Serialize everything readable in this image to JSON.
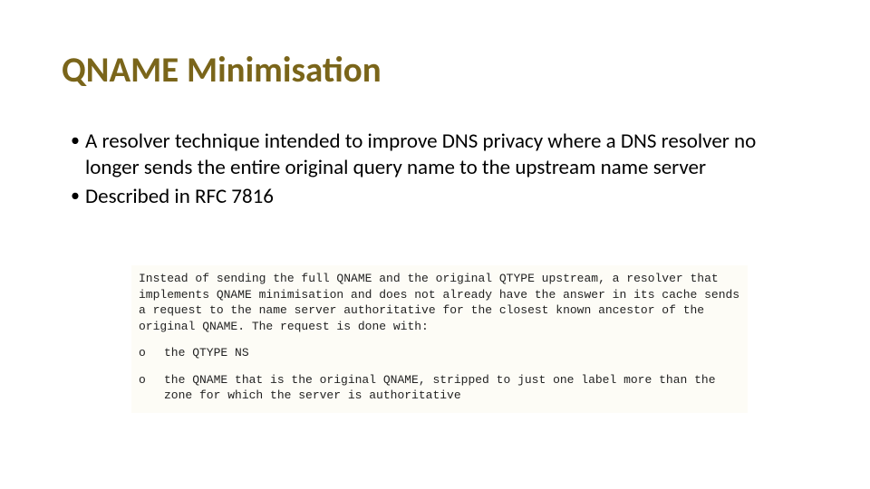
{
  "title": "QNAME Minimisation",
  "bullets": {
    "items": [
      {
        "marker": "•",
        "text": "A resolver technique intended to improve DNS privacy where a DNS resolver no longer sends the entire original query name to the upstream name server"
      },
      {
        "marker": "•",
        "text": "Described in RFC 7816"
      }
    ]
  },
  "excerpt": {
    "intro": "Instead of sending the full QNAME and the original QTYPE upstream, a resolver that implements QNAME minimisation and does not already have the answer in its cache sends a request to the name server authoritative for the closest known ancestor of the original QNAME. The request is done with:",
    "items": [
      {
        "marker": "o",
        "text": "the QTYPE NS"
      },
      {
        "marker": "o",
        "text": "the QNAME that is the original QNAME, stripped to just one label more than the zone for which the server is authoritative"
      }
    ]
  }
}
